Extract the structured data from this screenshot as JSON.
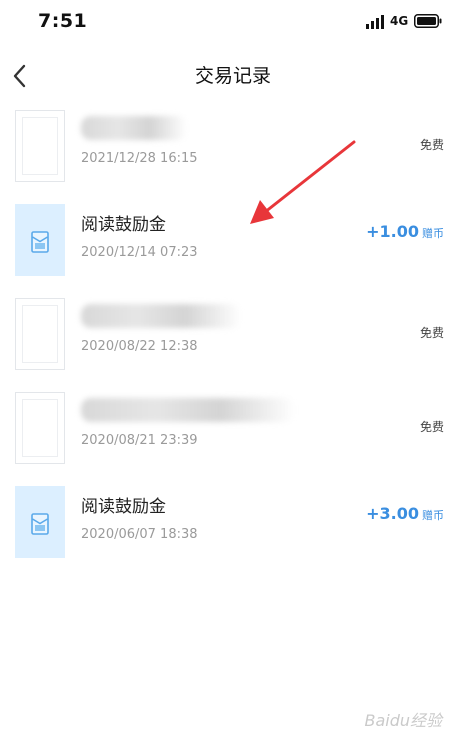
{
  "status_bar": {
    "time": "7:51",
    "network": "4G"
  },
  "header": {
    "title": "交易记录",
    "back_icon": "chevron-left-icon"
  },
  "transactions": [
    {
      "title": "",
      "date": "2021/12/28 16:15",
      "status": "免费",
      "amount": null,
      "unit": null,
      "title_blurred": true,
      "thumb": "book"
    },
    {
      "title": "阅读鼓励金",
      "date": "2020/12/14 07:23",
      "status": null,
      "amount": "+1.00",
      "unit": "赠币",
      "title_blurred": false,
      "thumb": "reward"
    },
    {
      "title": "",
      "date": "2020/08/22 12:38",
      "status": "免费",
      "amount": null,
      "unit": null,
      "title_blurred": true,
      "thumb": "book"
    },
    {
      "title": "",
      "date": "2020/08/21 23:39",
      "status": "免费",
      "amount": null,
      "unit": null,
      "title_blurred": true,
      "thumb": "book"
    },
    {
      "title": "阅读鼓励金",
      "date": "2020/06/07 18:38",
      "status": null,
      "amount": "+3.00",
      "unit": "赠币",
      "title_blurred": false,
      "thumb": "reward"
    }
  ],
  "annotation": {
    "arrow_color": "#e8363a"
  },
  "colors": {
    "accent": "#3a8ee0",
    "reward_bg": "#dcefff"
  },
  "watermark": "Baidu经验"
}
